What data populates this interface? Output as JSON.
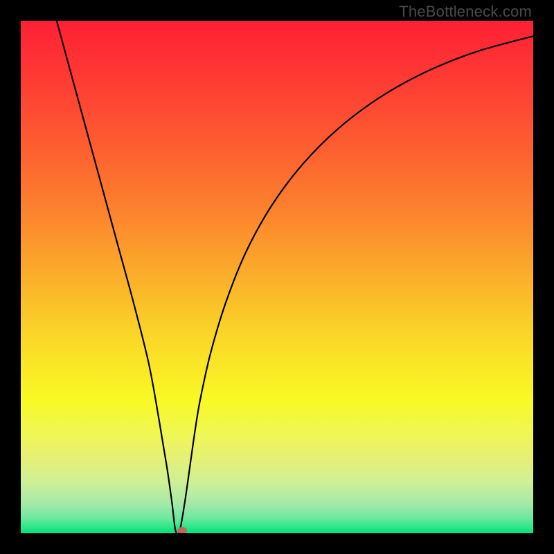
{
  "watermark": "TheBottleneck.com",
  "chart_data": {
    "type": "line",
    "title": "",
    "xlabel": "",
    "ylabel": "",
    "xlim": [
      0,
      100
    ],
    "ylim": [
      0,
      100
    ],
    "grid": false,
    "legend": false,
    "background_gradient_stops": [
      {
        "stop": 0.0,
        "color": "#fe2035"
      },
      {
        "stop": 0.12,
        "color": "#fe3c33"
      },
      {
        "stop": 0.25,
        "color": "#fd5f30"
      },
      {
        "stop": 0.38,
        "color": "#fc852d"
      },
      {
        "stop": 0.5,
        "color": "#fbaf2a"
      },
      {
        "stop": 0.62,
        "color": "#fad827"
      },
      {
        "stop": 0.74,
        "color": "#f9f924"
      },
      {
        "stop": 0.8,
        "color": "#f0f84f"
      },
      {
        "stop": 0.85,
        "color": "#e7f073"
      },
      {
        "stop": 0.9,
        "color": "#cff095"
      },
      {
        "stop": 0.94,
        "color": "#a8e9a8"
      },
      {
        "stop": 0.97,
        "color": "#6fe8a0"
      },
      {
        "stop": 1.0,
        "color": "#00e47b"
      }
    ],
    "series": [
      {
        "name": "bottleneck-curve",
        "color": "#000000",
        "x": [
          7,
          10,
          13,
          16,
          19,
          22,
          25,
          27,
          28.5,
          29.5,
          30.2,
          31,
          32,
          33,
          34,
          35,
          37,
          40,
          44,
          49,
          55,
          62,
          70,
          79,
          89,
          100
        ],
        "y": [
          100,
          89,
          78,
          67,
          56,
          45,
          33,
          22,
          13,
          6,
          0.5,
          0.5,
          6,
          13,
          20,
          26,
          35,
          45,
          55,
          64,
          72,
          79,
          85,
          90,
          94,
          97
        ]
      }
    ],
    "marker": {
      "name": "optimal-point",
      "x": 31.5,
      "y": 0.5,
      "color": "#c6645a"
    }
  }
}
